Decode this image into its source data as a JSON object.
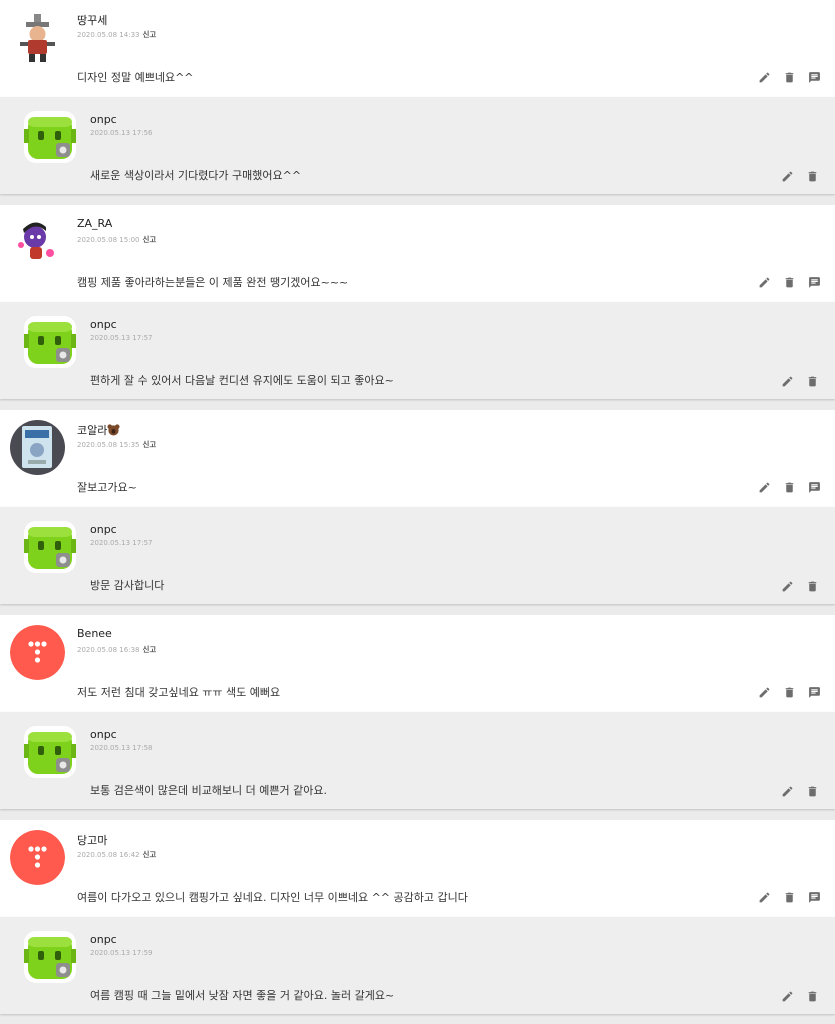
{
  "icons": {
    "edit": "pencil-icon",
    "delete": "trash-icon",
    "reply": "reply-comment-icon"
  },
  "colors": {
    "background": "#ebebeb",
    "comment_bg": "#ffffff",
    "reply_bg": "#eeeeee",
    "avatar_green": "#7ed21b",
    "avatar_red": "#ff5a4d",
    "icon_gray": "#6d6d6d"
  },
  "report_label": "신고",
  "threads": [
    {
      "comment": {
        "author": "땅꾸세",
        "date": "2020.05.08 14:33",
        "text": "디자인 정말 예쁘네요^^",
        "avatar": "character-avatar"
      },
      "reply": {
        "author": "onpc",
        "date": "2020.05.13 17:56",
        "text": "새로운 색상이라서 기다렸다가 구매했어요^^",
        "avatar": "green-robot-avatar"
      }
    },
    {
      "comment": {
        "author": "ZA_RA",
        "date": "2020.05.08 15:00",
        "text": "캠핑 제품 좋아라하는분들은 이 제품 완전 땡기겠어요~~~",
        "avatar": "purple-character-avatar"
      },
      "reply": {
        "author": "onpc",
        "date": "2020.05.13 17:57",
        "text": "편하게 잘 수 있어서 다음날 컨디션 유지에도 도움이 되고 좋아요~",
        "avatar": "green-robot-avatar"
      }
    },
    {
      "comment": {
        "author": "코알라",
        "author_emoji": "koala-icon",
        "date": "2020.05.08 15:35",
        "text": "잘보고가요~",
        "avatar": "book-photo-avatar"
      },
      "reply": {
        "author": "onpc",
        "date": "2020.05.13 17:57",
        "text": "방문 감사합니다",
        "avatar": "green-robot-avatar"
      }
    },
    {
      "comment": {
        "author": "Benee",
        "date": "2020.05.08 16:38",
        "text": "저도 저런 침대 갖고싶네요 ㅠㅠ 색도 예뻐요",
        "avatar": "red-t-avatar"
      },
      "reply": {
        "author": "onpc",
        "date": "2020.05.13 17:58",
        "text": "보통 검은색이 많은데 비교해보니 더 예쁜거 같아요.",
        "avatar": "green-robot-avatar"
      }
    },
    {
      "comment": {
        "author": "당고마",
        "date": "2020.05.08 16:42",
        "text": "여름이 다가오고 있으니 캠핑가고 싶네요. 디자인 너무 이쁘네요 ^^ 공감하고 갑니다",
        "avatar": "red-t-avatar"
      },
      "reply": {
        "author": "onpc",
        "date": "2020.05.13 17:59",
        "text": "여름 캠핑 때 그늘 밑에서 낮잠 자면 좋을 거 같아요. 놀러 갈게요~",
        "avatar": "green-robot-avatar"
      }
    }
  ]
}
